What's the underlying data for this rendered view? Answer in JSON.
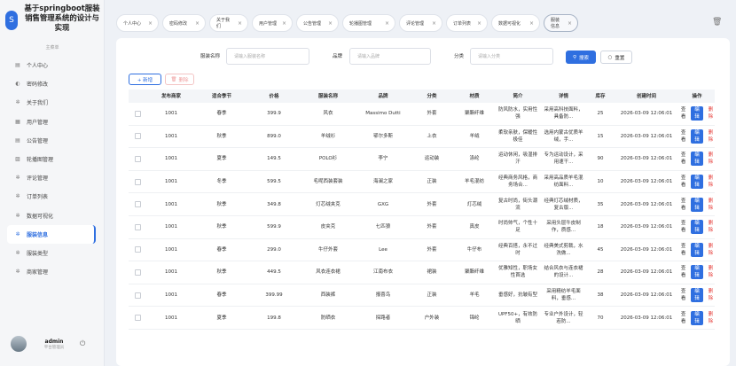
{
  "app": {
    "title": "基于springboot服装销售管理系统的设计与实现",
    "logo_glyph": "S"
  },
  "sidebar": {
    "caption": "主菜单",
    "items": [
      {
        "label": "个人中心",
        "icon": "▤"
      },
      {
        "label": "密码修改",
        "icon": "◐"
      },
      {
        "label": "关于我们",
        "icon": "✲"
      },
      {
        "label": "用户管理",
        "icon": "▦"
      },
      {
        "label": "公告管理",
        "icon": "▤"
      },
      {
        "label": "轮播图管理",
        "icon": "▨"
      },
      {
        "label": "评论管理",
        "icon": "✲"
      },
      {
        "label": "订单列表",
        "icon": "✲"
      },
      {
        "label": "数据可视化",
        "icon": "✲"
      },
      {
        "label": "服装信息",
        "icon": "✲",
        "active": true
      },
      {
        "label": "服装类型",
        "icon": "✲"
      },
      {
        "label": "商家管理",
        "icon": "✲"
      }
    ]
  },
  "user": {
    "name": "admin",
    "role": "平台管理员"
  },
  "tabs": [
    {
      "label": "个人中心"
    },
    {
      "label": "密码修改"
    },
    {
      "label": "关于我们"
    },
    {
      "label": "用户管理"
    },
    {
      "label": "公告管理"
    },
    {
      "label": "轮播图管理"
    },
    {
      "label": "评论管理"
    },
    {
      "label": "订单列表"
    },
    {
      "label": "数据可视化"
    },
    {
      "label": "服装信息",
      "active": true
    }
  ],
  "filters": {
    "name_label": "服装名称",
    "name_placeholder": "请输入服装名称",
    "brand_label": "品牌",
    "brand_placeholder": "请输入品牌",
    "category_label": "分类",
    "category_placeholder": "请输入分类",
    "search_label": "搜索",
    "reset_label": "重置"
  },
  "actions": {
    "add_label": "+ 新增",
    "delete_label": "删除"
  },
  "table": {
    "headers": [
      "发布商家",
      "适合季节",
      "价格",
      "服装名称",
      "品牌",
      "分类",
      "材质",
      "简介",
      "详情",
      "库存",
      "创建时间",
      "操作"
    ],
    "op_view": "查看",
    "op_edit": "编辑",
    "op_delete": "删除",
    "rows": [
      {
        "merchant": "1001",
        "season": "春季",
        "price": "399.9",
        "name": "风衣",
        "brand": "Massimo Dutti",
        "category": "外套",
        "material": "聚酯纤维",
        "intro": "防风防水，实用性强",
        "detail": "采用高科技面料，具备防...",
        "stock": "25",
        "created": "2026-03-09 12:06:01"
      },
      {
        "merchant": "1001",
        "season": "秋季",
        "price": "899.0",
        "name": "羊绒衫",
        "brand": "鄂尔多斯",
        "category": "上衣",
        "material": "羊绒",
        "intro": "柔软亲肤，保暖性极佳",
        "detail": "选用内蒙古优质羊绒，手...",
        "stock": "15",
        "created": "2026-03-09 12:06:01"
      },
      {
        "merchant": "1001",
        "season": "夏季",
        "price": "149.5",
        "name": "POLO衫",
        "brand": "李宁",
        "category": "运动装",
        "material": "涤纶",
        "intro": "运动休闲，吸湿排汗",
        "detail": "专为运动设计，采用速干...",
        "stock": "90",
        "created": "2026-03-09 12:06:01"
      },
      {
        "merchant": "1001",
        "season": "冬季",
        "price": "599.5",
        "name": "毛呢西装套装",
        "brand": "海澜之家",
        "category": "正装",
        "material": "羊毛混纺",
        "intro": "经典商务风格，商务场合...",
        "detail": "采用高品质羊毛混纺面料...",
        "stock": "10",
        "created": "2026-03-09 12:06:01"
      },
      {
        "merchant": "1001",
        "season": "秋季",
        "price": "349.8",
        "name": "灯芯绒夹克",
        "brand": "GXG",
        "category": "外套",
        "material": "灯芯绒",
        "intro": "复古时尚，街头潮流",
        "detail": "经典灯芯绒材质，复古版...",
        "stock": "35",
        "created": "2026-03-09 12:06:01"
      },
      {
        "merchant": "1001",
        "season": "秋季",
        "price": "599.9",
        "name": "皮夹克",
        "brand": "七匹狼",
        "category": "外套",
        "material": "真皮",
        "intro": "时尚帅气，个性十足",
        "detail": "采用头层牛皮制作，质感...",
        "stock": "18",
        "created": "2026-03-09 12:06:01"
      },
      {
        "merchant": "1001",
        "season": "春季",
        "price": "299.0",
        "name": "牛仔外套",
        "brand": "Lee",
        "category": "外套",
        "material": "牛仔布",
        "intro": "经典百搭，永不过时",
        "detail": "经典美式剪裁，水洗做...",
        "stock": "45",
        "created": "2026-03-09 12:06:01"
      },
      {
        "merchant": "1001",
        "season": "秋季",
        "price": "449.5",
        "name": "风衣连衣裙",
        "brand": "江南布衣",
        "category": "裙装",
        "material": "聚酯纤维",
        "intro": "优雅知性，职场女性首选",
        "detail": "结合风衣与连衣裙的设计...",
        "stock": "28",
        "created": "2026-03-09 12:06:01"
      },
      {
        "merchant": "1001",
        "season": "春季",
        "price": "399.99",
        "name": "西装裤",
        "brand": "报喜鸟",
        "category": "正装",
        "material": "羊毛",
        "intro": "垂感好，抗皱有型",
        "detail": "采用精纺羊毛面料，垂感...",
        "stock": "38",
        "created": "2026-03-09 12:06:01"
      },
      {
        "merchant": "1001",
        "season": "夏季",
        "price": "199.8",
        "name": "防晒衣",
        "brand": "探路者",
        "category": "户外装",
        "material": "锦纶",
        "intro": "UPF50+，有效防晒",
        "detail": "专业户外设计，轻若防...",
        "stock": "70",
        "created": "2026-03-09 12:06:01"
      }
    ]
  },
  "colors": {
    "primary": "#2f6fe0",
    "danger": "#e53935"
  }
}
